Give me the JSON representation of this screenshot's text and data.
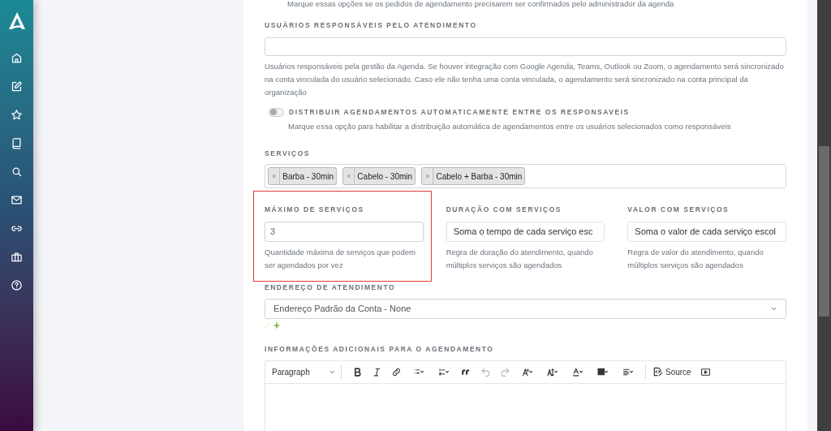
{
  "top_hint": "Marque essas opções se os pedidos de agendamento precisarem ser confirmados pelo administrador da agenda",
  "responsaveis": {
    "label": "USUÁRIOS RESPONSÁVEIS PELO ATENDIMENTO",
    "help": "Usuários responsáveis pela gestão da Agenda. Se houver integração com Google Agenda, Teams, Outlook ou Zoom, o agendamento será sincronizado na conta vinculada do usuário selecionado. Caso ele não tenha uma conta vinculada, o agendamento será sincronizado na conta principal da organização"
  },
  "distribuir": {
    "label": "DISTRIBUIR AGENDAMENTOS AUTOMATICAMENTE ENTRE OS RESPONSAVEIS",
    "on": false,
    "help": "Marque essa opção para habilitar a distribuição automática de agendamentos entre os usuários selecionados como responsáveis"
  },
  "servicos": {
    "label": "SERVIÇOS",
    "tags": [
      {
        "remove": "×",
        "label": "Barba - 30min"
      },
      {
        "remove": "×",
        "label": "Cabelo - 30min"
      },
      {
        "remove": "×",
        "label": "Cabelo + Barba - 30min"
      }
    ]
  },
  "fields": [
    {
      "kind": "input",
      "label": "MÁXIMO DE SERVIÇOS",
      "value": "3",
      "help": "Quantidade máxima de serviços que podem ser agendados por vez",
      "highlighted": true
    },
    {
      "kind": "select",
      "label": "DURAÇÃO COM SERVIÇOS",
      "value": "Soma o tempo de cada serviço esc",
      "help": "Regra de duração do atendimento, quando múltiplos serviços são agendados",
      "highlighted": false
    },
    {
      "kind": "select",
      "label": "VALOR COM SERVIÇOS",
      "value": "Soma o valor de cada serviço escol",
      "help": "Regra de valor do atendimento, quando múltiplos serviços são agendados",
      "highlighted": false
    }
  ],
  "endereco": {
    "label": "ENDEREÇO DE ATENDIMENTO",
    "value": "Endereço Padrão da Conta - None"
  },
  "informacoes": {
    "label": "INFORMAÇÕES ADICIONAIS PARA O AGENDAMENTO",
    "toolbar": [
      {
        "kind": "paragraph",
        "label": "Paragraph",
        "disabled": false
      },
      {
        "kind": "bold",
        "disabled": false
      },
      {
        "kind": "italic",
        "disabled": false
      },
      {
        "kind": "link",
        "disabled": false
      },
      {
        "kind": "bullets",
        "disabled": false
      },
      {
        "kind": "numbers",
        "disabled": false
      },
      {
        "kind": "quote",
        "disabled": false
      },
      {
        "kind": "undo",
        "disabled": true
      },
      {
        "kind": "redo",
        "disabled": true
      },
      {
        "kind": "fontsize",
        "disabled": false
      },
      {
        "kind": "fontfamily",
        "disabled": false
      },
      {
        "kind": "fontcolor",
        "disabled": false
      },
      {
        "kind": "highlight",
        "disabled": false
      },
      {
        "kind": "align",
        "disabled": false
      },
      {
        "kind": "source",
        "label": "Source",
        "disabled": false
      },
      {
        "kind": "media",
        "disabled": false
      }
    ]
  }
}
